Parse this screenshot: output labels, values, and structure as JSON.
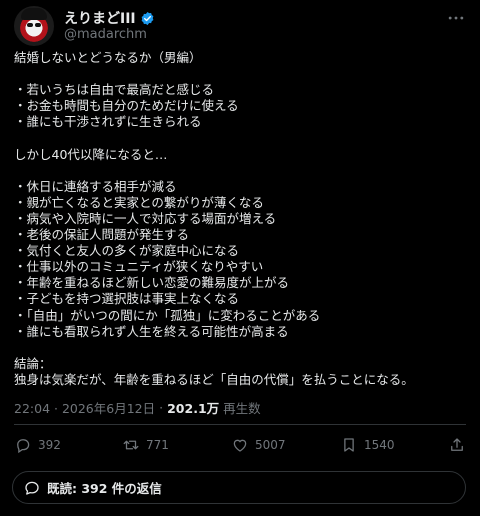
{
  "author": {
    "display_name": "えりまどIII",
    "handle": "@madarchm"
  },
  "post": {
    "text": "結婚しないとどうなるか（男編）\n\n・若いうちは自由で最高だと感じる\n・お金も時間も自分のためだけに使える\n・誰にも干渉されずに生きられる\n\nしかし40代以降になると…\n\n・休日に連絡する相手が減る\n・親が亡くなると実家との繋がりが薄くなる\n・病気や入院時に一人で対応する場面が増える\n・老後の保証人問題が発生する\n・気付くと友人の多くが家庭中心になる\n・仕事以外のコミュニティが狭くなりやすい\n・年齢を重ねるほど新しい恋愛の難易度が上がる\n・子どもを持つ選択肢は事実上なくなる\n・「自由」がいつの間にか「孤独」に変わることがある\n・誰にも看取られず人生を終える可能性が高まる\n\n結論：\n独身は気楽だが、年齢を重ねるほど「自由の代償」を払うことになる。",
    "timestamp": "22:04 · 2026年6月12日",
    "separator": "·",
    "views": "202.1万",
    "views_label": "再生数"
  },
  "stats": {
    "replies": "392",
    "reposts": "771",
    "likes": "5007",
    "bookmarks": "1540"
  },
  "reply_summary": "既読: 392 件の返信",
  "colors": {
    "background": "#000000",
    "text": "#e7e9ea",
    "muted": "#71767b",
    "verified": "#1d9bf0",
    "divider": "#2f3336"
  },
  "icons": [
    "verified-badge-icon",
    "more-icon",
    "reply-icon",
    "repost-icon",
    "like-icon",
    "bookmark-icon",
    "share-icon",
    "chat-bubble-icon"
  ]
}
